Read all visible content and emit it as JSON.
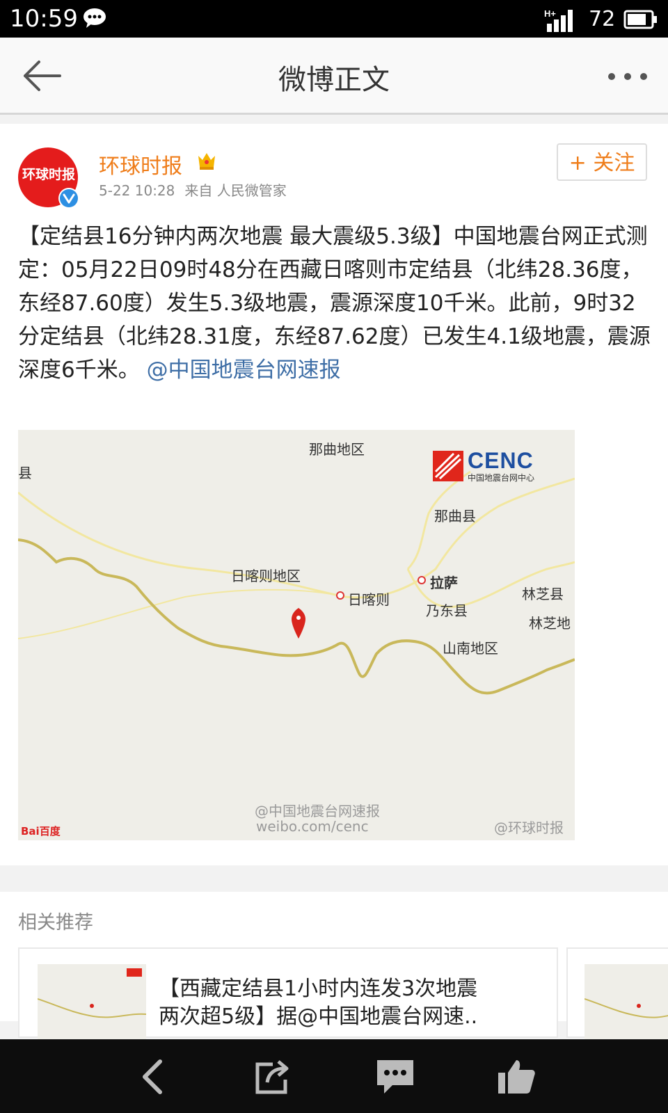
{
  "status_bar": {
    "time": "10:59",
    "network": "H+",
    "battery": "72",
    "icons": [
      "chat-icon",
      "signal-icon",
      "battery-icon"
    ]
  },
  "header": {
    "title": "微博正文",
    "back_icon": "arrow-left-icon",
    "more_icon": "more-dots-icon"
  },
  "post": {
    "author": "环球时报",
    "avatar_text": "环球时报",
    "crown_icon": "crown-icon",
    "verified_icon": "verified-badge-icon",
    "time": "5-22 10:28",
    "source": "来自 人民微管家",
    "follow_label": "+ 关注",
    "text": "【定结县16分钟内两次地震 最大震级5.3级】中国地震台网正式测定：05月22日09时48分在西藏日喀则市定结县（北纬28.36度，东经87.60度）发生5.3级地震，震源深度10千米。此前，9时32分定结县（北纬28.31度，东经87.62度）已发生4.1级地震，震源深度6千米。",
    "mention": "@中国地震台网速报",
    "map": {
      "logo": "CENC",
      "logo_sub": "中国地震台网中心",
      "labels": {
        "naqu_region": "那曲地区",
        "left_county": "县",
        "naqu_county": "那曲县",
        "shigatse_region": "日喀则地区",
        "shigatse": "日喀则",
        "lhasa": "拉萨",
        "naidong": "乃东县",
        "nyingchi_county": "林芝县",
        "nyingchi": "林芝地",
        "shannan": "山南地区"
      },
      "watermark_1": "@中国地震台网速报",
      "watermark_2": "weibo.com/cenc",
      "watermark_3": "@环球时报",
      "baidu": "Bai百度"
    }
  },
  "related": {
    "header": "相关推荐",
    "items": [
      {
        "title": "【西藏定结县1小时内连发3次地震\n两次超5级】据@中国地震台网速.."
      }
    ]
  },
  "bottom_bar": {
    "icons": [
      "back-chevron-icon",
      "share-icon",
      "comment-icon",
      "like-icon"
    ]
  },
  "colors": {
    "accent_orange": "#ef7d1a",
    "link_blue": "#3e6ea6",
    "cenc_red": "#e0261b",
    "cenc_blue": "#1e4fa0"
  }
}
